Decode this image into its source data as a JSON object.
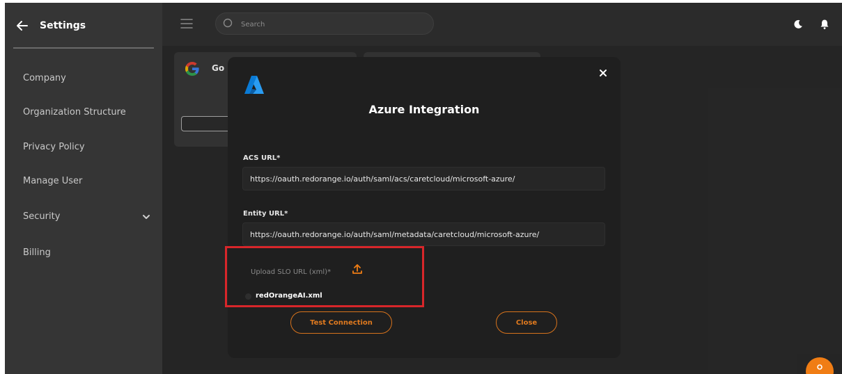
{
  "sidebar": {
    "title": "Settings",
    "items": [
      {
        "label": "Company"
      },
      {
        "label": "Organization Structure"
      },
      {
        "label": "Privacy Policy"
      },
      {
        "label": "Manage User"
      },
      {
        "label": "Security"
      },
      {
        "label": "Billing"
      }
    ]
  },
  "topbar": {
    "search_placeholder": "Search"
  },
  "background_cards": {
    "google_card_title": "Go"
  },
  "modal": {
    "title": "Azure Integration",
    "acs_url_label": "ACS URL*",
    "acs_url_value": "https://oauth.redorange.io/auth/saml/acs/caretcloud/microsoft-azure/",
    "entity_url_label": "Entity URL*",
    "entity_url_value": "https://oauth.redorange.io/auth/saml/metadata/caretcloud/microsoft-azure/",
    "upload_label": "Upload SLO URL (xml)*",
    "uploaded_file_name": "redOrangeAI.xml",
    "test_connection_label": "Test Connection",
    "close_label": "Close"
  },
  "colors": {
    "accent": "#e07a1f",
    "highlight": "#d8262a",
    "azure_blue": "#0a7bd6"
  },
  "icons": {
    "back": "arrow-left-icon",
    "security_expand": "chevron-down-icon",
    "menu": "hamburger-icon",
    "search": "search-icon",
    "theme": "moon-icon",
    "notifications": "bell-icon",
    "modal_close": "close-icon",
    "upload": "upload-icon",
    "integration_logo": "azure-logo"
  }
}
